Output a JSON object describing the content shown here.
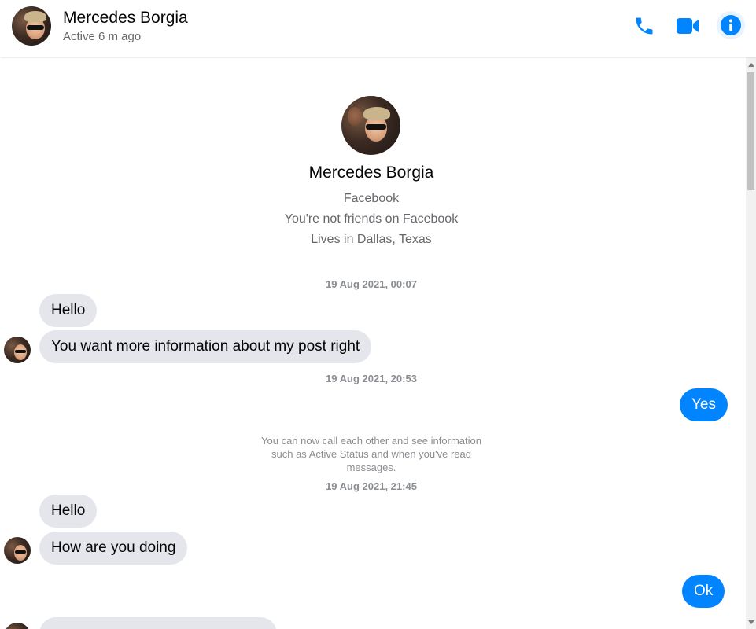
{
  "header": {
    "name": "Mercedes Borgia",
    "status": "Active 6 m ago",
    "icons": [
      "phone-icon",
      "video-camera-icon",
      "info-icon"
    ],
    "accent": "#0084ff"
  },
  "profile": {
    "name": "Mercedes Borgia",
    "source": "Facebook",
    "friendship": "You're not friends on Facebook",
    "location": "Lives in Dallas, Texas"
  },
  "conversation": {
    "timestamp_1": "19 Aug 2021, 00:07",
    "msg_1": "Hello",
    "msg_2": "You want more information about my post right",
    "timestamp_2": "19 Aug 2021, 20:53",
    "msg_3": "Yes",
    "system_note": "You can now call each other and see information such as Active Status and when you've read messages.",
    "timestamp_3": "19 Aug 2021, 21:45",
    "msg_4": "Hello",
    "msg_5": "How are you doing",
    "msg_6": "Ok"
  },
  "colors": {
    "incoming_bubble": "#e4e6eb",
    "outgoing_bubble": "#0084ff",
    "secondary_text": "#65676b"
  }
}
